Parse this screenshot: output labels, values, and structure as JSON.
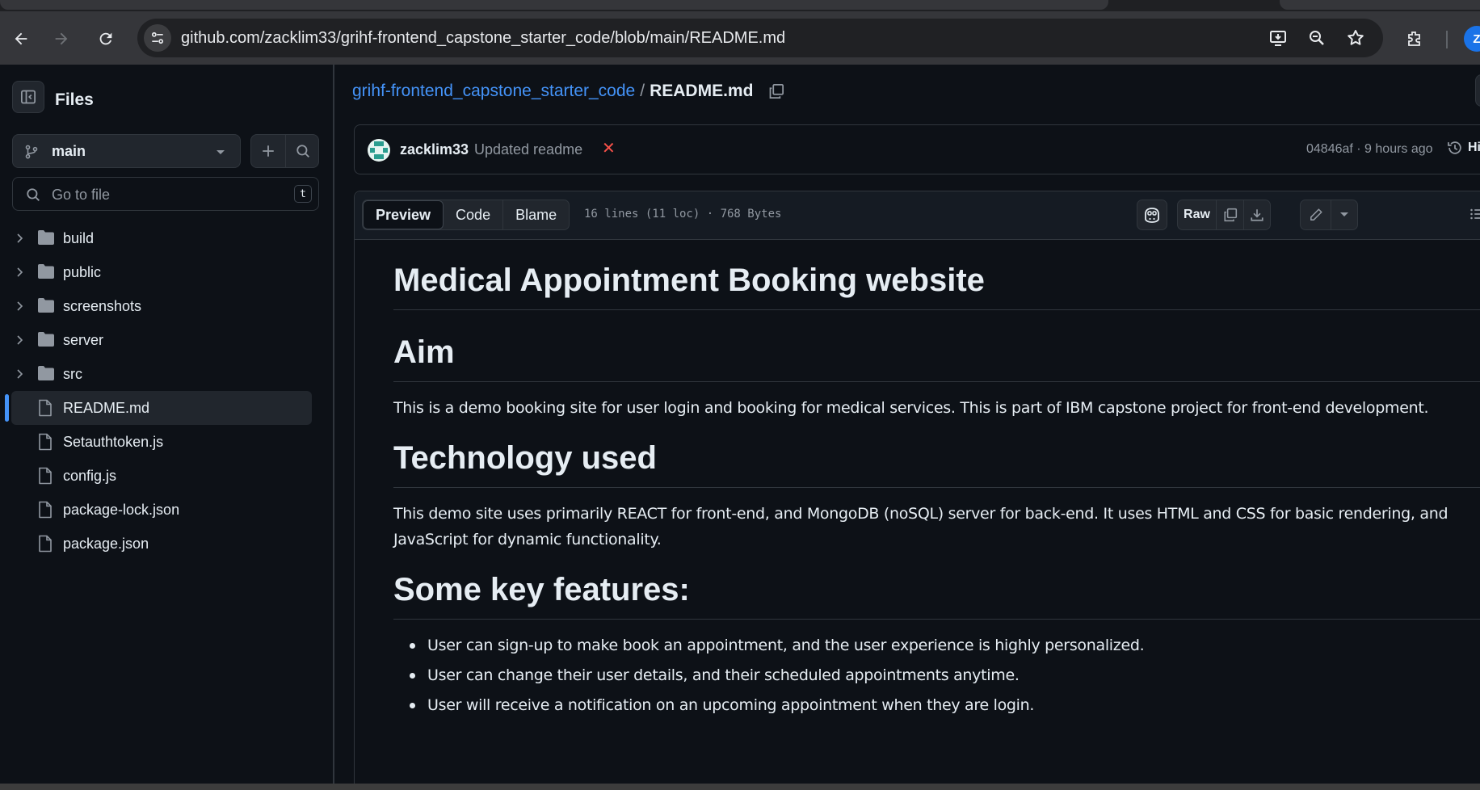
{
  "browser": {
    "url": "github.com/zacklim33/grihf-frontend_capstone_starter_code/blob/main/README.md",
    "profile_initial": "Z"
  },
  "sidebar": {
    "title": "Files",
    "branch": "main",
    "search": {
      "placeholder": "Go to file",
      "shortcut": "t"
    },
    "items": [
      {
        "label": "build",
        "type": "folder"
      },
      {
        "label": "public",
        "type": "folder"
      },
      {
        "label": "screenshots",
        "type": "folder"
      },
      {
        "label": "server",
        "type": "folder"
      },
      {
        "label": "src",
        "type": "folder"
      },
      {
        "label": "README.md",
        "type": "file",
        "active": true
      },
      {
        "label": "Setauthtoken.js",
        "type": "file"
      },
      {
        "label": "config.js",
        "type": "file"
      },
      {
        "label": "package-lock.json",
        "type": "file"
      },
      {
        "label": "package.json",
        "type": "file"
      }
    ]
  },
  "breadcrumb": {
    "repo": "grihf-frontend_capstone_starter_code",
    "separator": "/",
    "file": "README.md"
  },
  "commit": {
    "author": "zacklim33",
    "message": "Updated readme",
    "status": "✕",
    "meta": "04846af · 9 hours ago",
    "history_label": "Histo"
  },
  "file_header": {
    "tabs": [
      "Preview",
      "Code",
      "Blame"
    ],
    "active_tab": "Preview",
    "stats": "16 lines (11 loc) · 768 Bytes",
    "raw_label": "Raw"
  },
  "readme": {
    "title": "Medical Appointment Booking website",
    "aim_heading": "Aim",
    "aim_text": "This is a demo booking site for user login and booking for medical services. This is part of IBM capstone project for front-end development.",
    "tech_heading": "Technology used",
    "tech_text": "This demo site uses primarily REACT for front-end, and MongoDB (noSQL) server for back-end. It uses HTML and CSS for basic rendering, and JavaScript for dynamic functionality.",
    "features_heading": "Some key features:",
    "features": [
      "User can sign-up to make book an appointment, and the user experience is highly personalized.",
      "User can change their user details, and their scheduled appointments anytime.",
      "User will receive a notification on an upcoming appointment when they are login."
    ]
  },
  "colors": {
    "accent": "#4493f8",
    "background": "#0d1117",
    "border": "#30363d",
    "danger": "#f85149"
  }
}
